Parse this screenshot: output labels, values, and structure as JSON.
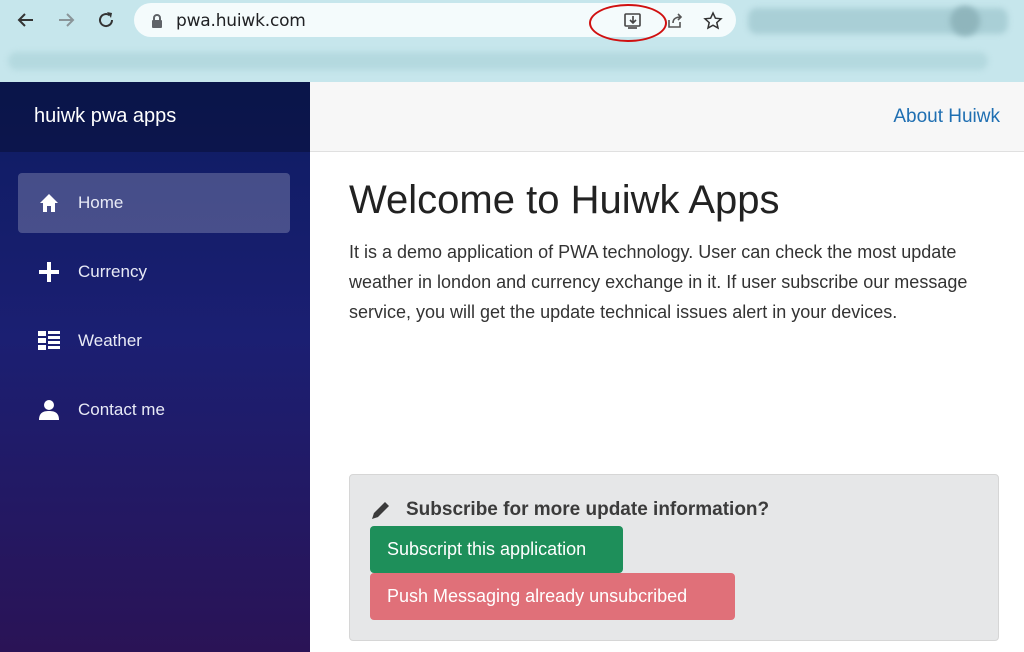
{
  "browser": {
    "url": "pwa.huiwk.com",
    "icons": [
      "back-icon",
      "forward-icon",
      "reload-icon",
      "lock-icon",
      "install-app-icon",
      "share-icon",
      "bookmark-star-icon"
    ]
  },
  "sidebar": {
    "brand": "huiwk pwa apps",
    "items": [
      {
        "label": "Home",
        "icon": "home-icon",
        "active": true
      },
      {
        "label": "Currency",
        "icon": "plus-icon",
        "active": false
      },
      {
        "label": "Weather",
        "icon": "list-icon",
        "active": false
      },
      {
        "label": "Contact me",
        "icon": "person-icon",
        "active": false
      }
    ]
  },
  "header": {
    "about_link": "About Huiwk"
  },
  "main": {
    "title": "Welcome to Huiwk Apps",
    "intro": "It is a demo application of PWA technology. User can check the most update weather in london and currency exchange in it. If user subscribe our message service, you will get the update technical issues alert in your devices."
  },
  "subscribe": {
    "heading": "Subscribe for more update information?",
    "subscribe_button": "Subscript this application",
    "status_button": "Push Messaging already unsubcribed"
  },
  "colors": {
    "sidebar_top": "#0d1c62",
    "sidebar_bottom": "#2a1356",
    "link": "#1f6fb2",
    "success": "#1e8f5a",
    "danger": "#e07079",
    "annotation": "#d01010"
  }
}
